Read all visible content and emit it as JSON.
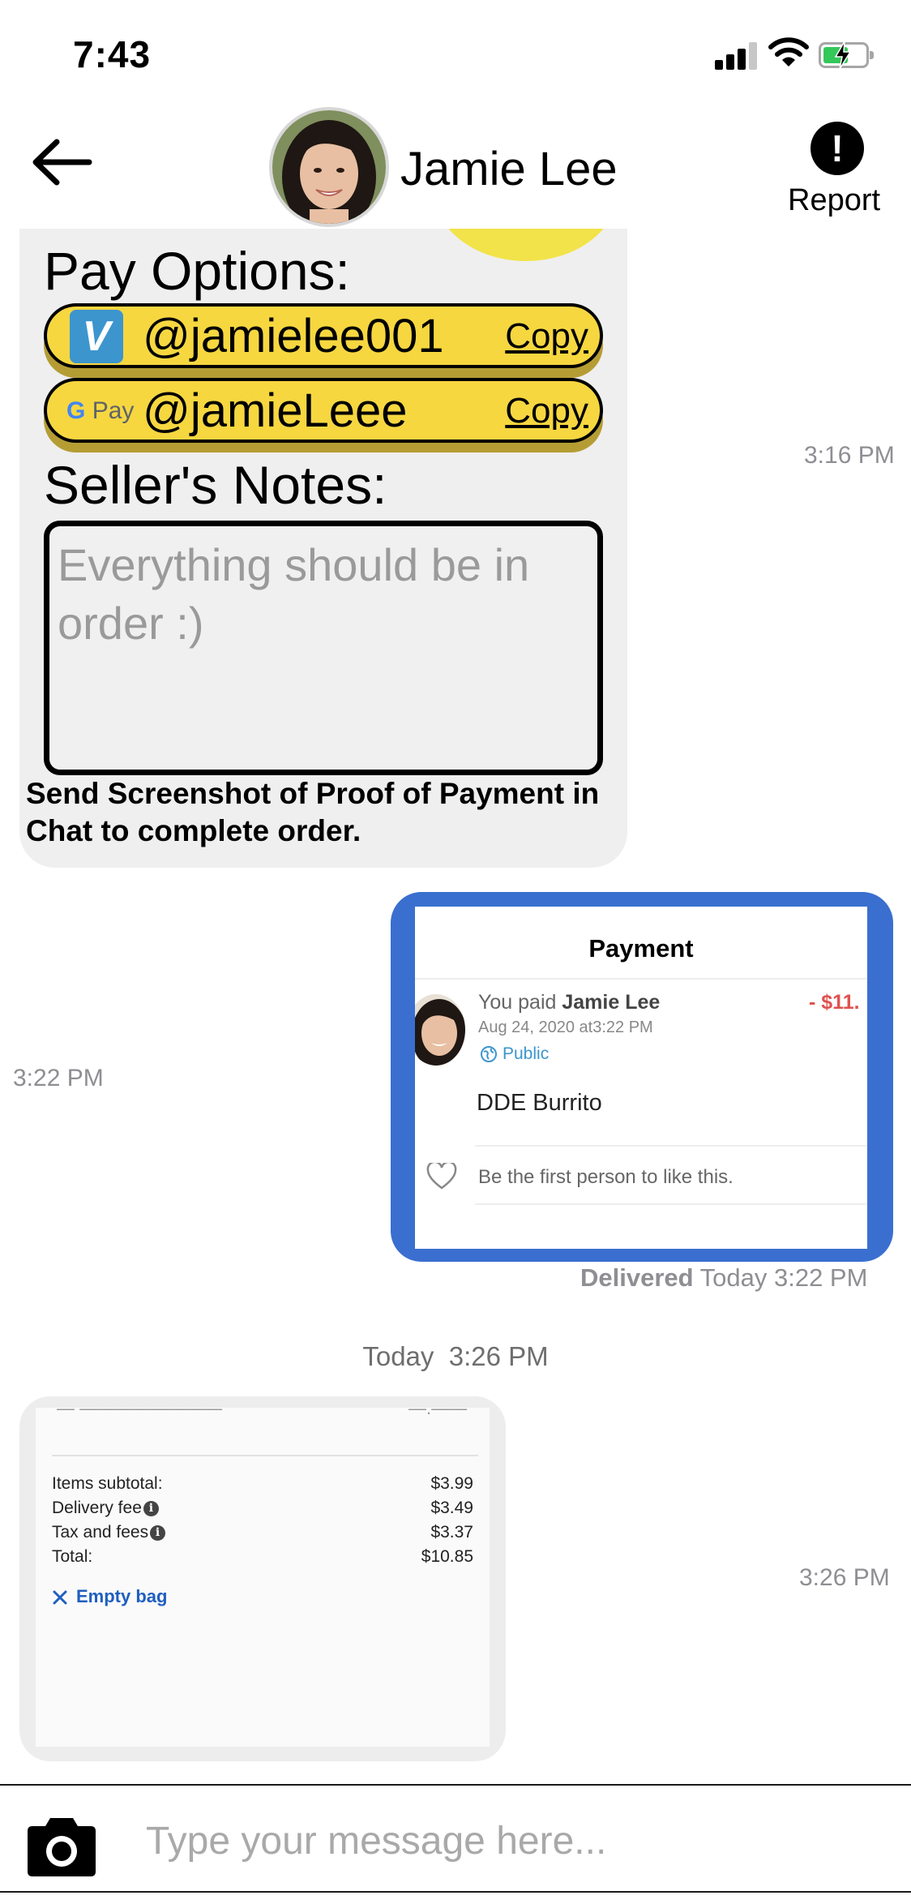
{
  "status_bar": {
    "time": "7:43"
  },
  "header": {
    "contact_name": "Jamie Lee",
    "report_label": "Report",
    "report_icon_glyph": "!"
  },
  "pay_card": {
    "title": "Pay Options:",
    "options": [
      {
        "service_icon": "venmo-icon",
        "icon_text": "V",
        "handle": "@jamielee001",
        "copy_label": "Copy"
      },
      {
        "service_icon": "google-pay-icon",
        "icon_g": "G",
        "icon_text": "Pay",
        "handle": "@jamieLeee",
        "copy_label": "Copy"
      }
    ],
    "notes_title": "Seller's Notes:",
    "notes_text": "Everything should be in order :)",
    "instruction": "Send Screenshot of Proof of Payment in Chat to complete order.",
    "timestamp": "3:16 PM"
  },
  "payment_message": {
    "title": "Payment",
    "paid_prefix": "You paid",
    "payee": "Jamie Lee",
    "amount": "- $11.",
    "date": "Aug 24, 2020 at3:22 PM",
    "visibility": "Public",
    "item": "DDE Burrito",
    "like_text": "Be the first person to like this.",
    "timestamp": "3:22 PM",
    "delivered_label": "Delivered",
    "delivered_time": "Today 3:22 PM"
  },
  "day_separator": {
    "label": "Today",
    "time": "3:26 PM"
  },
  "receipt_message": {
    "rows": [
      {
        "label": "Items subtotal:",
        "value": "$3.99",
        "info": false
      },
      {
        "label": "Delivery fee",
        "value": "$3.49",
        "info": true
      },
      {
        "label": "Tax and fees",
        "value": "$3.37",
        "info": true
      },
      {
        "label": "Total:",
        "value": "$10.85",
        "info": false
      }
    ],
    "empty_bag": "Empty bag",
    "timestamp": "3:26 PM"
  },
  "composer": {
    "placeholder": "Type your message here..."
  },
  "colors": {
    "pay_pill": "#f6d740",
    "pay_pill_shadow": "#b59d34",
    "venmo": "#3d95ce",
    "screenshot_border": "#3a6fd0",
    "amount_red": "#e0514f",
    "battery_green": "#34c759"
  }
}
